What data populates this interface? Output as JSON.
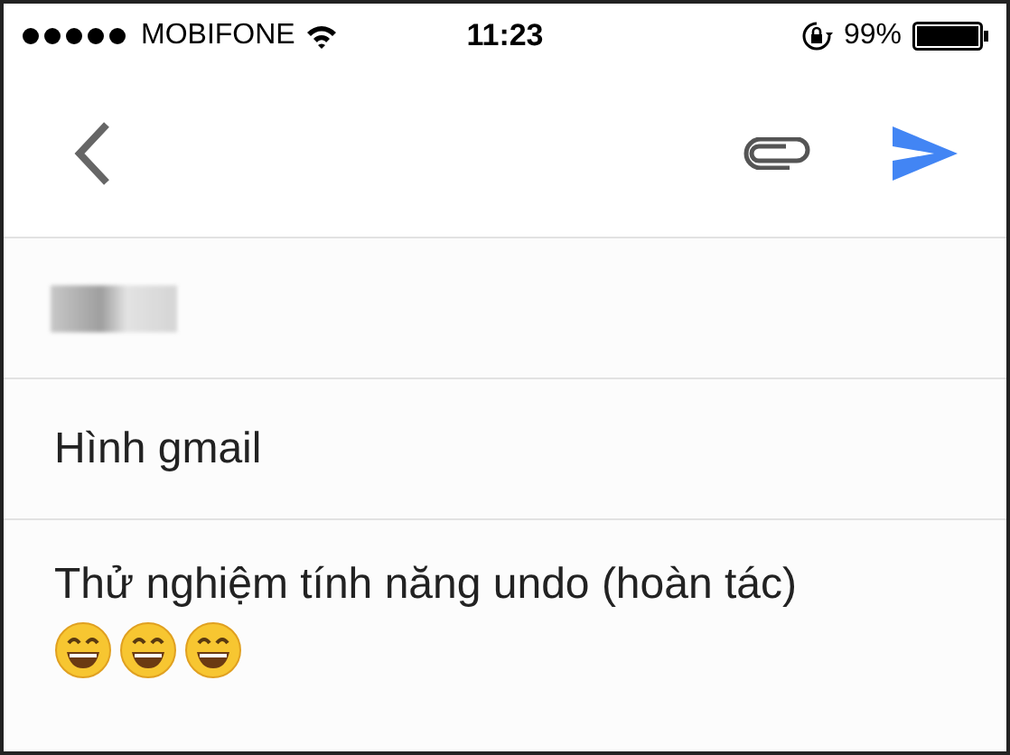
{
  "status_bar": {
    "carrier": "MOBIFONE",
    "time": "11:23",
    "battery": "99%"
  },
  "compose": {
    "subject": "Hình gmail",
    "body": "Thử nghiệm tính năng undo (hoàn tác)"
  }
}
